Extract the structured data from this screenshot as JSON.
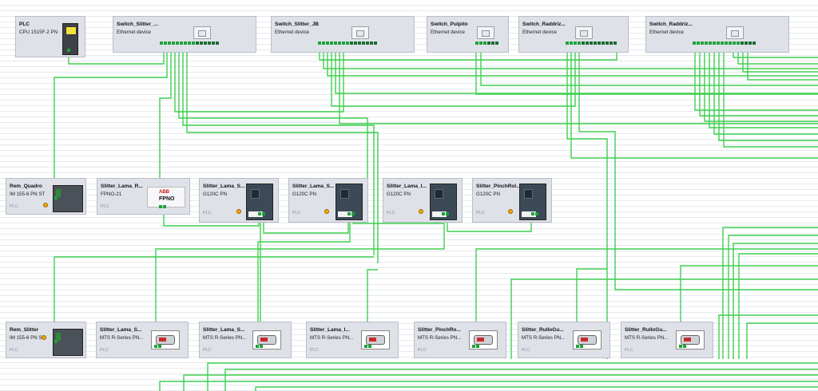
{
  "devices": {
    "plc": {
      "name": "PLC",
      "type": "CPU 1515F-2 PN"
    },
    "sw1": {
      "name": "Switch_Slitter_...",
      "type": "Ethernet device"
    },
    "sw2": {
      "name": "Switch_Slitter_JB",
      "type": "Ethernet device"
    },
    "sw3": {
      "name": "Switch_Pulpito",
      "type": "Ethernet device"
    },
    "sw4": {
      "name": "Switch_Raddriz...",
      "type": "Ethernet device"
    },
    "sw5": {
      "name": "Switch_Raddriz...",
      "type": "Ethernet device"
    },
    "rem_quadro": {
      "name": "Rem_Quadro",
      "type": "IM 155-6 PN ST",
      "tag": "PLC"
    },
    "lama_r": {
      "name": "Slitter_Lama_R...",
      "type": "FPNO-21",
      "tag": "PLC",
      "logo": "ABB",
      "brand": "FPNO"
    },
    "lama_s1": {
      "name": "Slitter_Lama_S...",
      "type": "G120C PN",
      "tag": "PLC"
    },
    "lama_s2": {
      "name": "Slitter_Lama_S...",
      "type": "G120C PN",
      "tag": "PLC"
    },
    "lama_i": {
      "name": "Slitter_Lama_I...",
      "type": "G120C PN",
      "tag": "PLC"
    },
    "pinch": {
      "name": "Slitter_PinchRol...",
      "type": "G120C PN",
      "tag": "PLC"
    },
    "rem_slitter": {
      "name": "Rem_Slitter",
      "type": "IM 155-6 PN ST",
      "tag": "PLC"
    },
    "mts1": {
      "name": "Slitter_Lama_S...",
      "type": "MTS R-Series PN...",
      "tag": "PLC"
    },
    "mts2": {
      "name": "Slitter_Lama_S...",
      "type": "MTS R-Series PN...",
      "tag": "PLC"
    },
    "mts3": {
      "name": "Slitter_Lama_I...",
      "type": "MTS R-Series PN...",
      "tag": "PLC"
    },
    "mts4": {
      "name": "Slitter_PinchRo...",
      "type": "MTS R-Series PN...",
      "tag": "PLC"
    },
    "mts5": {
      "name": "Slitter_RulloGu...",
      "type": "MTS R-Series PN...",
      "tag": "PLC"
    },
    "mts6": {
      "name": "Slitter_RulloGu...",
      "type": "MTS R-Series PN...",
      "tag": "PLC"
    }
  },
  "colors": {
    "link": "#3fcf4f",
    "port": "#1ea23a",
    "box": "#dfe1e8",
    "grid": "#e7e9ed"
  }
}
